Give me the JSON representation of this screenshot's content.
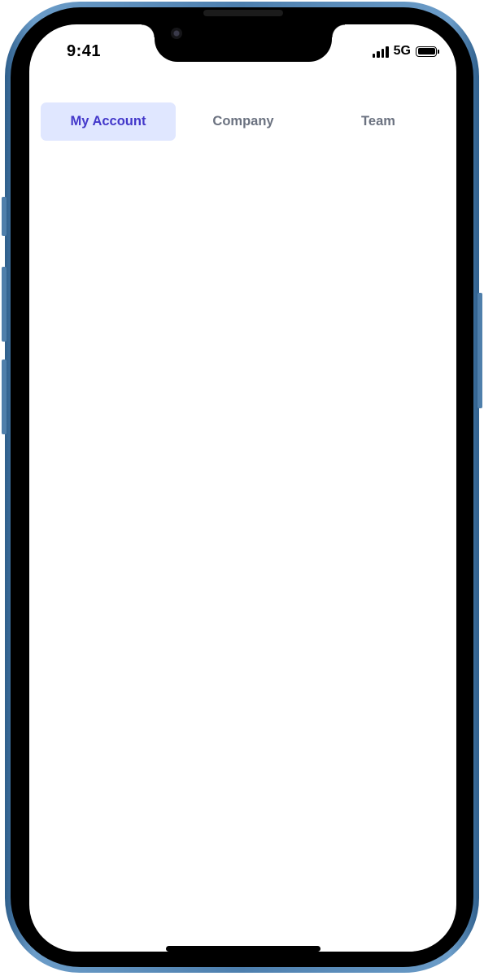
{
  "status_bar": {
    "time": "9:41",
    "network": "5G"
  },
  "tabs": [
    {
      "label": "My Account",
      "active": true
    },
    {
      "label": "Company",
      "active": false
    },
    {
      "label": "Team",
      "active": false
    }
  ],
  "colors": {
    "active_tab_bg": "#e0e7ff",
    "active_tab_text": "#4338ca",
    "inactive_tab_text": "#6b7280",
    "device_frame": "#4d7fae"
  }
}
